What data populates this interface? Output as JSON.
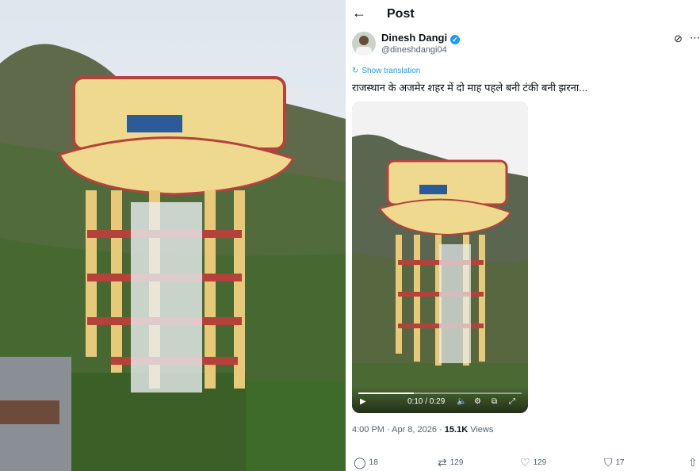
{
  "header": {
    "title": "Post",
    "back_icon": "arrow-left-icon"
  },
  "author": {
    "name": "Dinesh Dangi",
    "handle": "@dineshdangi04",
    "verified": true,
    "verified_icon": "verified-badge-icon",
    "avatar_icon": "avatar"
  },
  "menu": {
    "grok_icon": "grok-icon",
    "more_icon": "more-icon"
  },
  "translate": {
    "icon": "translate-icon",
    "label": "Show translation"
  },
  "tweet": {
    "text": "राजस्थान के अजमेर शहर में दो माह पहले बनी टंकी बनी झरना..."
  },
  "video": {
    "time": "0:10 / 0:29",
    "play_icon": "play-icon",
    "volume_icon": "volume-icon",
    "settings_icon": "settings-icon",
    "pip_icon": "pip-icon",
    "fullscreen_icon": "fullscreen-icon",
    "progress": 0.34
  },
  "meta": {
    "time": "4:00 PM · Apr 8, 2026 ·",
    "views": "15.1K",
    "views_label": "Views"
  },
  "actions": {
    "replies": "18",
    "reposts": "129",
    "likes": "129",
    "bookmarks": "17"
  },
  "colors": {
    "accent": "#1d9bf0",
    "text": "#0f1419",
    "muted": "#536471",
    "tank": "#f0dc9a",
    "tank_band": "#b5423a"
  }
}
